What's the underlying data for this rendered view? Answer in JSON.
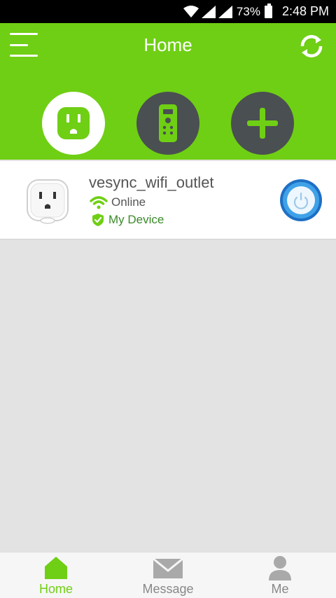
{
  "status_bar": {
    "battery": "73%",
    "time": "2:48 PM"
  },
  "header": {
    "title": "Home"
  },
  "categories": [
    {
      "icon": "outlet-icon",
      "active": true
    },
    {
      "icon": "remote-icon",
      "active": false
    },
    {
      "icon": "plus-icon",
      "active": false
    }
  ],
  "device": {
    "name": "vesync_wifi_outlet",
    "status": "Online",
    "ownership": "My Device",
    "icons": [
      "outlet-device-icon",
      "wifi-icon",
      "shield-check-icon",
      "power-icon"
    ]
  },
  "tabs": [
    {
      "label": "Home",
      "icon": "home-icon",
      "active": true
    },
    {
      "label": "Message",
      "icon": "envelope-icon",
      "active": false
    },
    {
      "label": "Me",
      "icon": "person-icon",
      "active": false
    }
  ],
  "colors": {
    "accent": "#6fcf14",
    "dark_circle": "#4a4f52",
    "power_blue": "#1e6fc4",
    "verified_green": "#3a8a2a"
  }
}
